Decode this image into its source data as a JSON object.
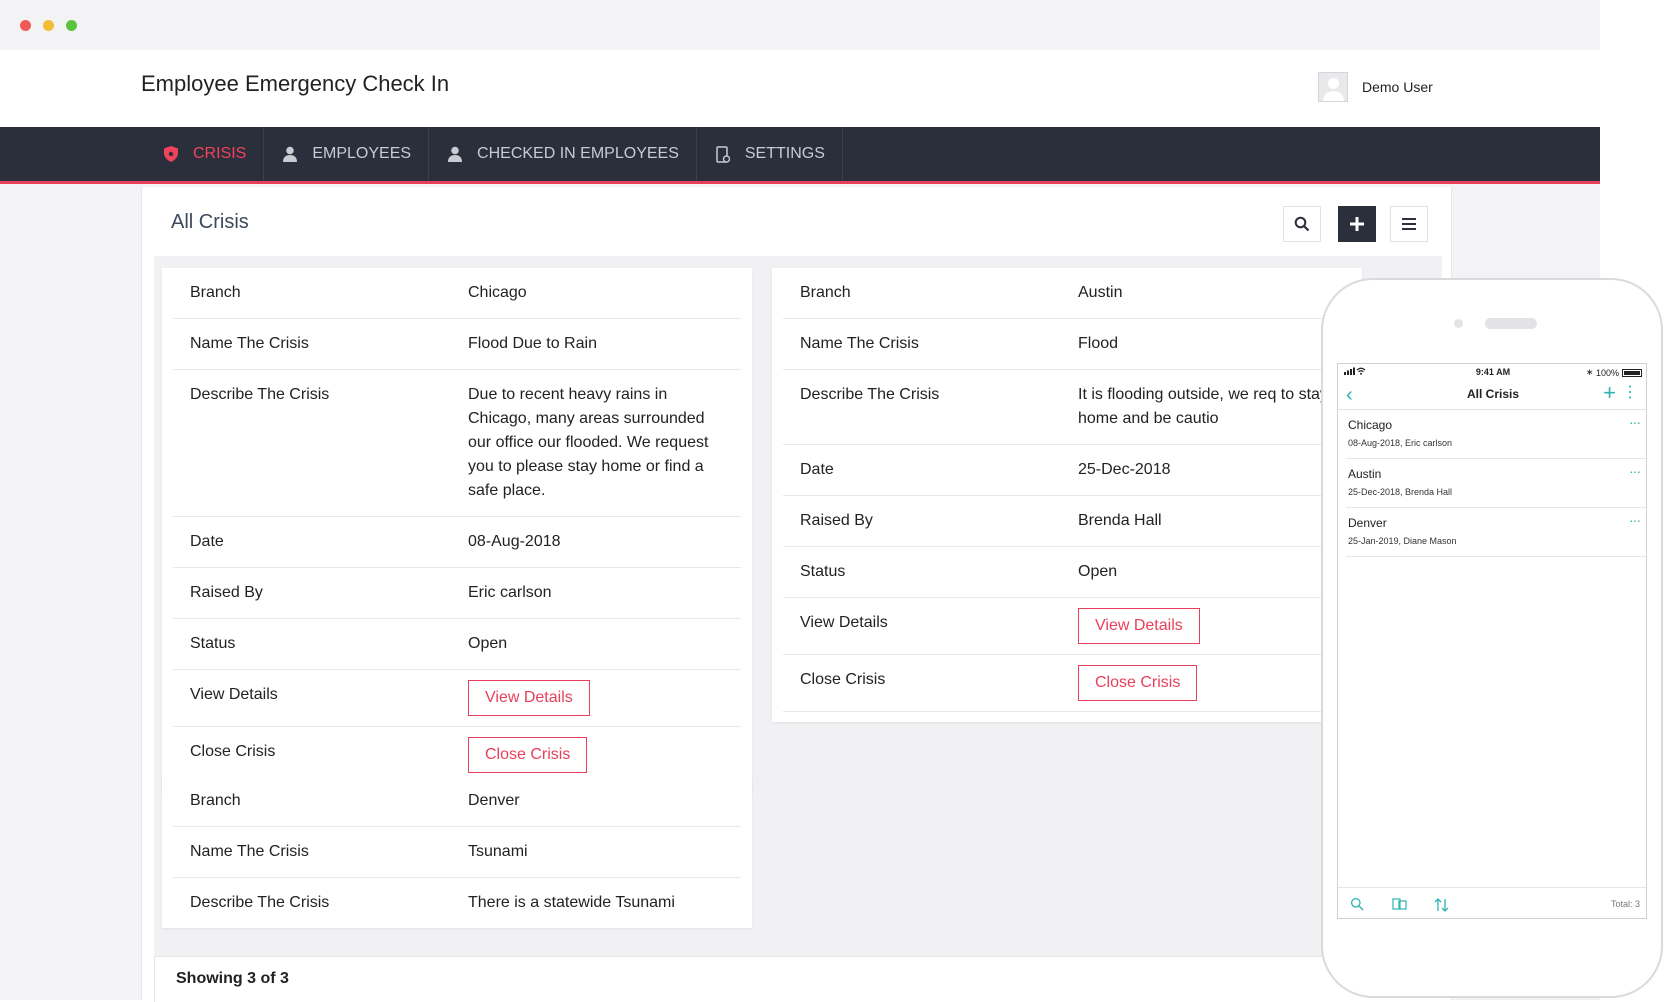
{
  "browser": {
    "app_title": "Employee Emergency Check In",
    "user_name": "Demo User"
  },
  "nav": {
    "items": [
      {
        "label": "CRISIS",
        "icon": "shield-icon"
      },
      {
        "label": "EMPLOYEES",
        "icon": "person-icon"
      },
      {
        "label": "CHECKED IN EMPLOYEES",
        "icon": "person-icon"
      },
      {
        "label": "SETTINGS",
        "icon": "settings-icon"
      }
    ],
    "active_color": "#f0435c",
    "bar_color": "#2b2e3b",
    "accent_border": "#e8405a"
  },
  "page": {
    "title": "All Crisis",
    "footer": "Showing 3 of 3"
  },
  "labels": {
    "branch": "Branch",
    "name": "Name The Crisis",
    "describe": "Describe The Crisis",
    "date": "Date",
    "raised_by": "Raised By",
    "status": "Status",
    "view_details": "View Details",
    "close_crisis": "Close Crisis"
  },
  "buttons": {
    "view_details": "View Details",
    "close_crisis": "Close Crisis"
  },
  "crises": [
    {
      "branch": "Chicago",
      "name": "Flood Due to Rain",
      "description": "Due to recent heavy rains in Chicago, many areas surrounded our office our flooded. We request you to please stay home or find a safe place.",
      "date": "08-Aug-2018",
      "raised_by": "Eric carlson",
      "status": "Open"
    },
    {
      "branch": "Austin",
      "name": "Flood",
      "description": "It is flooding outside, we req to stay home and be cautio",
      "date": "25-Dec-2018",
      "raised_by": "Brenda Hall",
      "status": "Open"
    },
    {
      "branch": "Denver",
      "name": "Tsunami",
      "description": "There is a statewide Tsunami"
    }
  ],
  "mobile": {
    "time": "9:41 AM",
    "battery": "100%",
    "title": "All Crisis",
    "items": [
      {
        "city": "Chicago",
        "meta": "08-Aug-2018,  Eric carlson",
        "more": "···"
      },
      {
        "city": "Austin",
        "meta": "25-Dec-2018,  Brenda Hall",
        "more": "···"
      },
      {
        "city": "Denver",
        "meta": "25-Jan-2019,  Diane Mason",
        "more": "···"
      }
    ],
    "total": "Total: 3",
    "accent": "#2db4b0"
  }
}
